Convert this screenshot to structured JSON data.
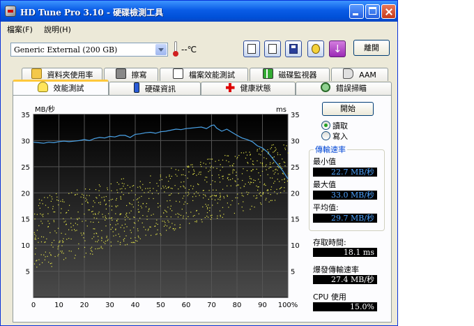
{
  "window": {
    "title": "HD Tune Pro 3.10 - 硬碟檢測工具"
  },
  "menu": [
    "檔案(F)",
    "說明(H)"
  ],
  "toolbar": {
    "drive": "Generic External (200 GB)",
    "temperature": "--℃",
    "exit_label": "離開",
    "icons": [
      "copy-info-icon",
      "copy-screen-icon",
      "save-icon",
      "settings-icon",
      "download-icon"
    ]
  },
  "tabs_row1": [
    {
      "label": "資料夾使用率",
      "icon": "folder-icon"
    },
    {
      "label": "擦寫",
      "icon": "trash-icon"
    },
    {
      "label": "檔案效能測試",
      "icon": "file-benchmark-icon"
    },
    {
      "label": "磁碟監視器",
      "icon": "disk-monitor-icon"
    },
    {
      "label": "AAM",
      "icon": "speaker-icon"
    }
  ],
  "tabs_row2": [
    {
      "label": "效能測試",
      "icon": "lightbulb-icon",
      "active": true
    },
    {
      "label": "硬碟資訊",
      "icon": "info-icon"
    },
    {
      "label": "健康狀態",
      "icon": "health-cross-icon"
    },
    {
      "label": "錯誤掃瞄",
      "icon": "magnifier-icon"
    }
  ],
  "controls": {
    "start_label": "開始",
    "read_label": "讀取",
    "write_label": "寫入",
    "mode": "read"
  },
  "stats": {
    "group_title": "傳輸速率",
    "min_label": "最小值",
    "min_value": "22.7 MB/秒",
    "max_label": "最大值",
    "max_value": "33.0 MB/秒",
    "avg_label": "平均值:",
    "avg_value": "29.7 MB/秒",
    "access_label": "存取時間:",
    "access_value": "18.1 ms",
    "burst_label": "爆發傳輸速率",
    "burst_value": "27.4 MB/秒",
    "cpu_label": "CPU 使用",
    "cpu_value": "15.0%"
  },
  "colors": {
    "transfer_line": "#4aa3e8",
    "access_points": "#e8e84a",
    "chart_bg_top": "#000000",
    "chart_bg_bottom": "#4a4a4a"
  },
  "chart_data": {
    "type": "line",
    "ylabel_left": "MB/秒",
    "ylabel_right": "ms",
    "x_ticks": [
      "0",
      "10",
      "20",
      "30",
      "40",
      "50",
      "60",
      "70",
      "80",
      "90",
      "100%"
    ],
    "y_ticks_left": [
      "5",
      "10",
      "15",
      "20",
      "25",
      "30",
      "35"
    ],
    "y_ticks_right": [
      "5",
      "10",
      "15",
      "20",
      "25",
      "30",
      "35"
    ],
    "xlim": [
      0,
      100
    ],
    "ylim": [
      0,
      35
    ],
    "grid": true,
    "series": [
      {
        "x": [
          0,
          2,
          4,
          6,
          8,
          10,
          12,
          14,
          16,
          18,
          20,
          22,
          24,
          26,
          28,
          30,
          32,
          34,
          36,
          38,
          40,
          42,
          44,
          46,
          48,
          50,
          52,
          54,
          56,
          58,
          60,
          62,
          64,
          66,
          68,
          70,
          71,
          72,
          74,
          76,
          78,
          80,
          82,
          84,
          86,
          88,
          90,
          92,
          94,
          96,
          98,
          100
        ],
        "y": [
          29.7,
          29.6,
          29.5,
          29.7,
          29.6,
          29.8,
          29.9,
          29.8,
          29.9,
          30.0,
          30.2,
          30.0,
          30.4,
          30.6,
          30.5,
          30.8,
          30.7,
          31.0,
          31.0,
          30.6,
          31.2,
          31.3,
          31.5,
          31.6,
          31.4,
          31.7,
          31.8,
          32.0,
          32.2,
          32.1,
          32.3,
          32.4,
          32.5,
          32.6,
          32.3,
          32.9,
          33.0,
          32.4,
          31.8,
          32.2,
          31.6,
          31.0,
          30.5,
          30.2,
          29.8,
          29.0,
          28.6,
          27.8,
          26.6,
          25.4,
          24.2,
          22.7
        ]
      }
    ],
    "access_time_scatter": {
      "x_range": [
        0,
        100
      ],
      "y_start_range": [
        5,
        19
      ],
      "y_end_range": [
        19,
        30
      ]
    }
  }
}
